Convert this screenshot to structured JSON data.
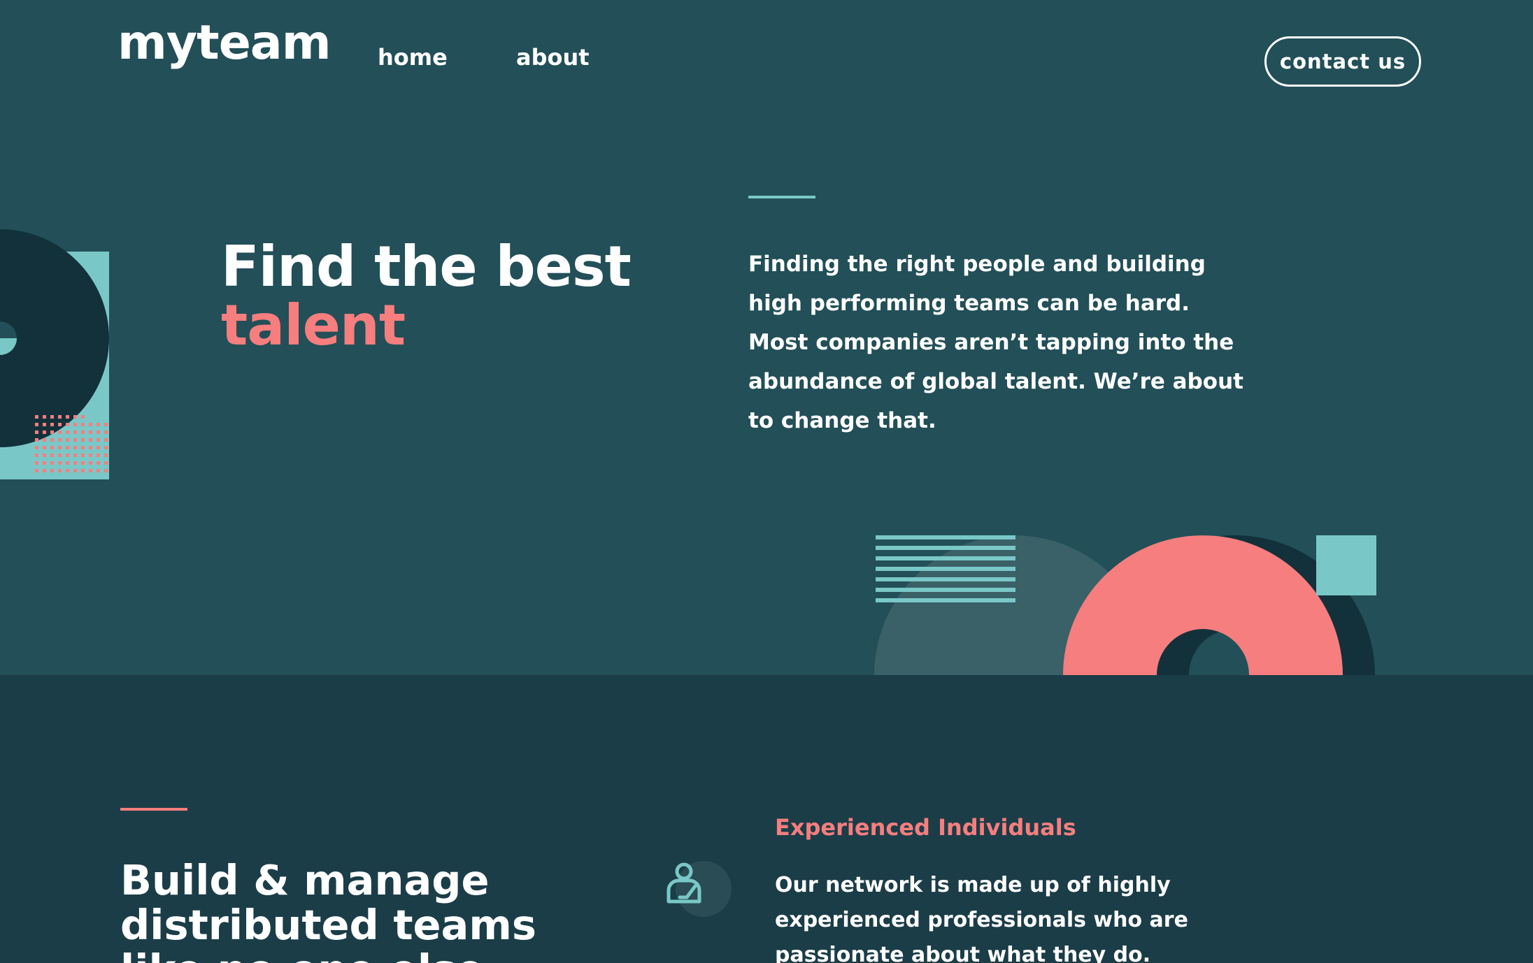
{
  "header": {
    "logo": "myteam",
    "nav": {
      "home": "home",
      "about": "about"
    },
    "contact_button": "contact us"
  },
  "hero": {
    "title_line1": "Find the best",
    "title_line2": "talent",
    "description": "Finding the right people and building high performing teams can be hard. Most companies aren’t tapping into the abundance of global talent. We’re about to change that."
  },
  "features": {
    "title": "Build & manage distributed teams like no one else.",
    "item": {
      "heading": "Experienced Individuals",
      "text": "Our network is made up of highly experienced professionals who are passionate about what they do.",
      "icon": "person-icon"
    }
  },
  "colors": {
    "hero_bg": "#224f58",
    "section_bg": "#1b3d48",
    "dark_teal": "#12313a",
    "coral": "#f67e7e",
    "light_teal": "#79c8c7",
    "white": "#ffffff"
  }
}
